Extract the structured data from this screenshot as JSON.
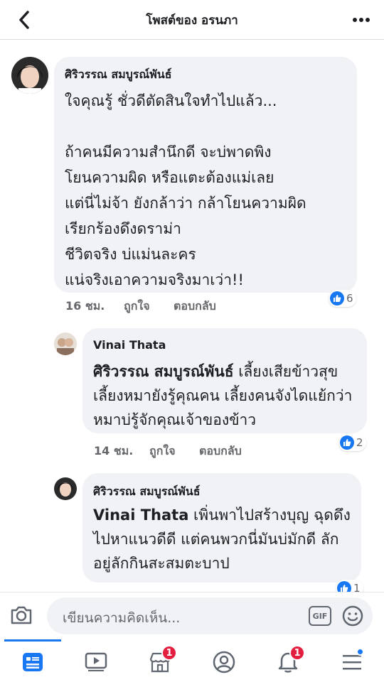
{
  "header": {
    "title": "โพสต์ของ อรนภา",
    "back_icon": "back-arrow-icon",
    "more_icon": "more-dots-icon"
  },
  "comments": [
    {
      "author": "ศิริวรรณ สมบูรณ์พันธ์",
      "text": "ใจคุณรู้ ชั่วดีตัดสินใจทำไปแล้ว...\n\nถ้าคนมีความสำนึกดี จะบ่พาดพิง\nโยนความผิด หรือแตะต้องแม่เลย\nแต่นี่ไม่จ้า ยังกล้าว่า กล้าโยนความผิด\nเรียกร้องดึงดราม่า\nชีวิตจริง บ่แม่นละคร\nแน่จริงเอาความจริงมาเว่า!!",
      "time": "16 ชม.",
      "like_label": "ถูกใจ",
      "reply_label": "ตอบกลับ",
      "reactions": "6"
    },
    {
      "author": "Vinai Thata",
      "mention": "ศิริวรรณ สมบูรณ์พันธ์",
      "text": " เลี้ยงเสียข้าวสุข  เลี้ยงหมายังรู้คุณคน เลี้ยงคนจังไดแย้กว่าหมาบ่รู้จักคุณเจ้าของข้าว",
      "time": "14 ชม.",
      "like_label": "ถูกใจ",
      "reply_label": "ตอบกลับ",
      "reactions": "2"
    },
    {
      "author": "ศิริวรรณ สมบูรณ์พันธ์",
      "mention": "Vinai Thata",
      "text": " เพิ่นพาไปสร้างบุญ ฉุดดึงไปหาแนวดีดี แต่คนพวกนี่มันบ่มักดี ลักอยู่ลักกินสะสมตะบาป",
      "reactions": "1"
    }
  ],
  "composer": {
    "placeholder": "เขียนความคิดเห็น...",
    "gif_label": "GIF"
  },
  "nav": {
    "items": [
      "feed-icon",
      "watch-icon",
      "marketplace-icon",
      "profile-icon",
      "notifications-icon",
      "menu-icon"
    ],
    "marketplace_badge": "1",
    "notifications_badge": "1"
  },
  "colors": {
    "accent": "#1877f2",
    "badge": "#e41e3f",
    "bubble": "#f0f2f5"
  }
}
